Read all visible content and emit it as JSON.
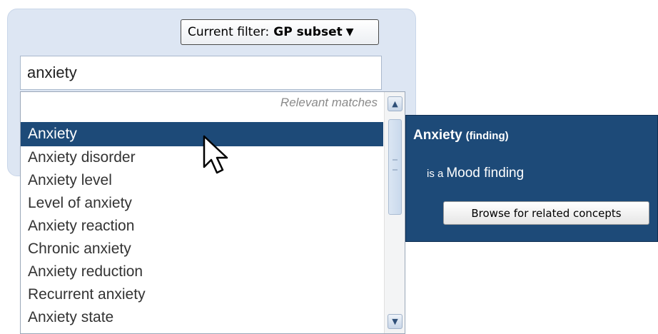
{
  "filter": {
    "prefix": "Current filter:",
    "value": "GP subset",
    "arrow": "▼"
  },
  "search": {
    "value": "anxiety"
  },
  "dropdown": {
    "header": "Relevant matches",
    "items": [
      {
        "label": "Anxiety",
        "selected": true
      },
      {
        "label": "Anxiety disorder"
      },
      {
        "label": "Anxiety level"
      },
      {
        "label": "Level of anxiety"
      },
      {
        "label": "Anxiety reaction"
      },
      {
        "label": "Chronic anxiety"
      },
      {
        "label": "Anxiety reduction"
      },
      {
        "label": "Recurrent anxiety"
      },
      {
        "label": "Anxiety state"
      }
    ],
    "scroll_up_icon": "▲",
    "scroll_down_icon": "▼"
  },
  "detail": {
    "name": "Anxiety",
    "tag": "(finding)",
    "relation_prefix": "is a",
    "relation_target": "Mood finding",
    "browse_label": "Browse for related concepts"
  },
  "icons": {
    "cursor": "arrow-pointer-icon",
    "scroll_up": "chevron-up-icon",
    "scroll_down": "chevron-down-icon",
    "filter_arrow": "triangle-down-icon"
  },
  "colors": {
    "selection": "#1d4a78",
    "panel_background": "#dde6f3",
    "detail_background": "#1d4a78"
  }
}
